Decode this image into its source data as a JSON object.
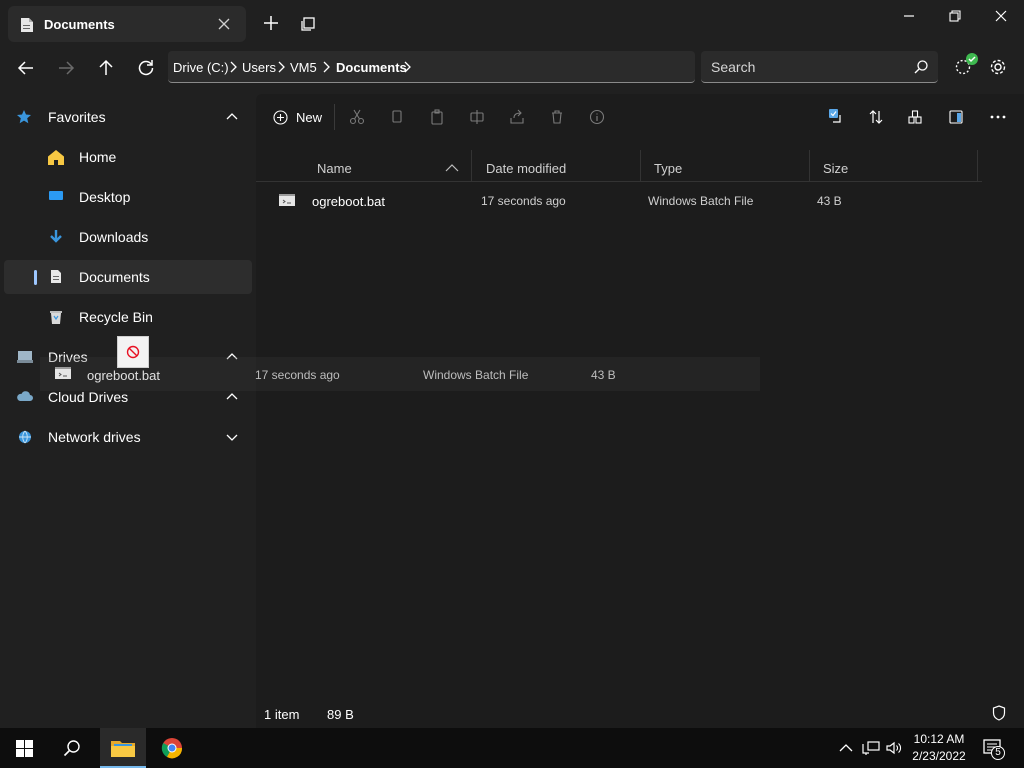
{
  "window": {
    "tab_title": "Documents",
    "accent": "#76b9ed"
  },
  "nav": {
    "breadcrumbs": [
      "Drive (C:)",
      "Users",
      "VM5",
      "Documents"
    ],
    "search_placeholder": "Search"
  },
  "sidebar": {
    "favorites": "Favorites",
    "items": [
      {
        "label": "Home",
        "icon": "home-icon"
      },
      {
        "label": "Desktop",
        "icon": "desktop-icon"
      },
      {
        "label": "Downloads",
        "icon": "download-icon"
      },
      {
        "label": "Documents",
        "icon": "document-icon"
      },
      {
        "label": "Recycle Bin",
        "icon": "recycle-bin-icon"
      }
    ],
    "sections": [
      {
        "label": "Drives",
        "icon": "drive-icon"
      },
      {
        "label": "Cloud Drives",
        "icon": "cloud-icon"
      },
      {
        "label": "Network drives",
        "icon": "network-icon"
      }
    ]
  },
  "toolbar": {
    "new_label": "New"
  },
  "columns": {
    "name": "Name",
    "date": "Date modified",
    "type": "Type",
    "size": "Size"
  },
  "files": [
    {
      "name": "ogreboot.bat",
      "date": "17 seconds ago",
      "type": "Windows Batch File",
      "size": "43 B"
    }
  ],
  "drag": {
    "name": "ogreboot.bat",
    "date": "17 seconds ago",
    "type": "Windows Batch File",
    "size": "43 B"
  },
  "status": {
    "items": "1 item",
    "size": "89 B"
  },
  "taskbar": {
    "time": "10:12 AM",
    "date": "2/23/2022",
    "notifications": "5"
  }
}
